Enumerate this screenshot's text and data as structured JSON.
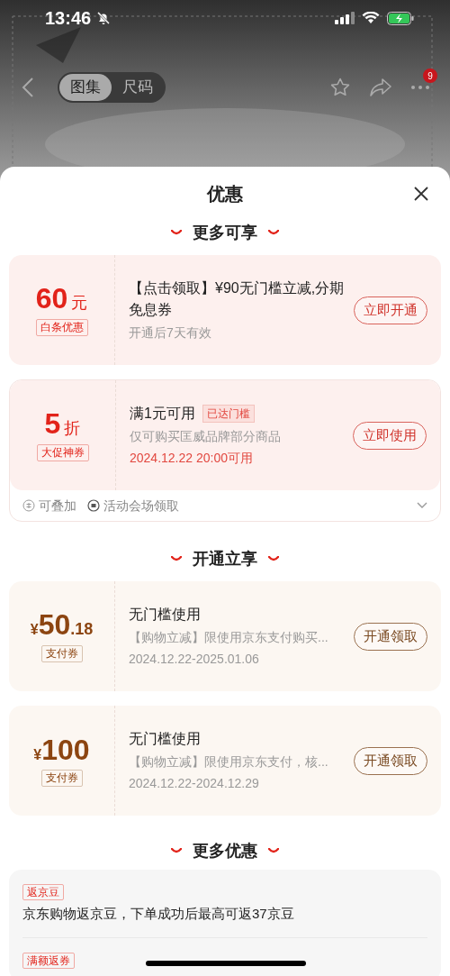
{
  "status_bar": {
    "time": "13:46"
  },
  "nav": {
    "tabs": [
      {
        "label": "图集",
        "selected": true
      },
      {
        "label": "尺码",
        "selected": false
      }
    ],
    "more_badge": "9"
  },
  "sheet": {
    "title": "优惠",
    "sections": [
      {
        "title": "更多可享",
        "coupons": [
          {
            "kind": "promo",
            "amount": {
              "main": "60",
              "suffix": "元"
            },
            "tag": "白条优惠",
            "title": "【点击领取】¥90无门槛立减,分期免息券",
            "lines": [
              {
                "text": "开通后7天有效",
                "highlight": false
              }
            ],
            "button": "立即开通"
          },
          {
            "kind": "promo",
            "amount": {
              "main": "5",
              "suffix": "折"
            },
            "tag": "大促神券",
            "title": "满1元可用",
            "badge": "已达门槛",
            "lines": [
              {
                "text": "仅可购买匡威品牌部分商品",
                "highlight": false
              },
              {
                "text": "2024.12.22 20:00可用",
                "highlight": true
              }
            ],
            "button": "立即使用",
            "footer": {
              "expanded": false,
              "items": [
                {
                  "kind": "stackable",
                  "text": "可叠加"
                },
                {
                  "kind": "venue",
                  "text": "活动会场领取"
                }
              ]
            }
          }
        ]
      },
      {
        "title": "开通立享",
        "coupons": [
          {
            "kind": "payment",
            "amount": {
              "prefix": "¥",
              "main": "50",
              "suffix": ".18"
            },
            "tag": "支付券",
            "title": "无门槛使用",
            "lines": [
              {
                "text": "【购物立减】限使用京东支付购买...",
                "highlight": false
              },
              {
                "text": "2024.12.22-2025.01.06",
                "highlight": false
              }
            ],
            "button": "开通领取"
          },
          {
            "kind": "payment",
            "amount": {
              "prefix": "¥",
              "main": "100"
            },
            "tag": "支付券",
            "title": "无门槛使用",
            "lines": [
              {
                "text": "【购物立减】限使用京东支付，核...",
                "highlight": false
              },
              {
                "text": "2024.12.22-2024.12.29",
                "highlight": false
              }
            ],
            "button": "开通领取"
          }
        ]
      },
      {
        "title": "更多优惠",
        "offers": [
          {
            "tag": "返京豆",
            "text": "京东购物返京豆，下单成功后最高可返37京豆"
          },
          {
            "tag": "满额返券"
          }
        ]
      }
    ]
  }
}
